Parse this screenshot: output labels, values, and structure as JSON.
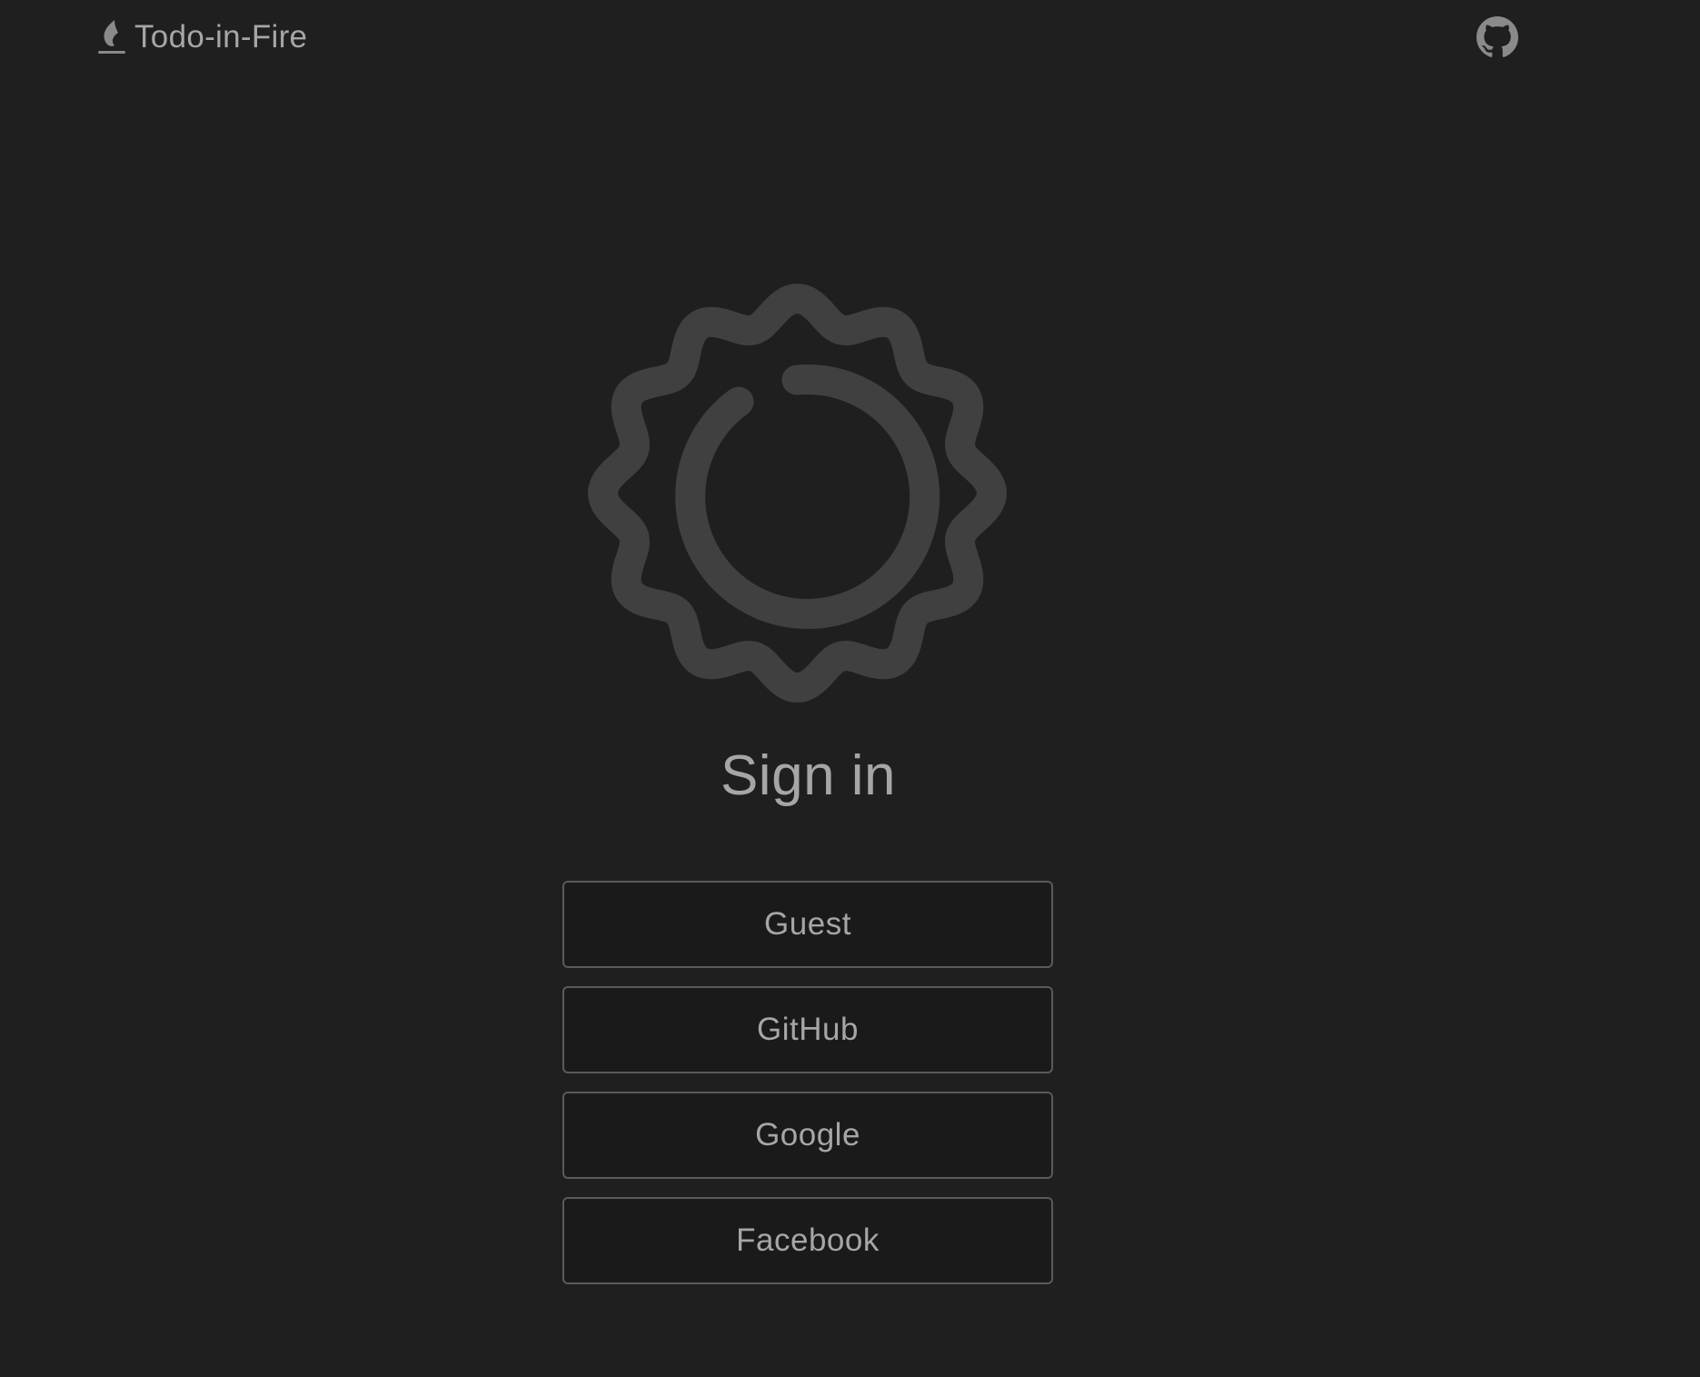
{
  "header": {
    "app_title": "Todo-in-Fire",
    "brand_icon": "flame-icon",
    "github_icon": "github-icon"
  },
  "main": {
    "logo_icon": "sun-spinner-icon",
    "title": "Sign in",
    "buttons": [
      {
        "label": "Guest"
      },
      {
        "label": "GitHub"
      },
      {
        "label": "Google"
      },
      {
        "label": "Facebook"
      }
    ]
  },
  "colors": {
    "background": "#1f1f1f",
    "text": "#a6a6a6",
    "logo": "#404040",
    "button_border": "#5a5a5a"
  }
}
